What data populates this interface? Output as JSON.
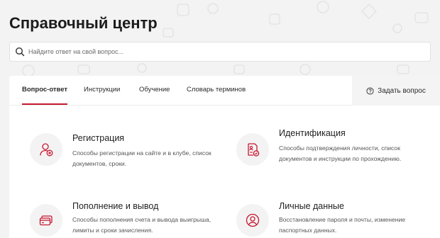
{
  "page": {
    "title": "Справочный центр"
  },
  "search": {
    "placeholder": "Найдите ответ на свой вопрос..."
  },
  "tabs": [
    {
      "label": "Вопрос-ответ",
      "active": true
    },
    {
      "label": "Инструкции",
      "active": false
    },
    {
      "label": "Обучение",
      "active": false
    },
    {
      "label": "Словарь терминов",
      "active": false
    }
  ],
  "ask_button": {
    "label": "Задать вопрос",
    "icon": "question-circle-icon"
  },
  "sections": [
    {
      "title": "Регистрация",
      "description": "Способы регистрации на сайте и в клубе, список документов, сроки.",
      "icon": "user-add-icon"
    },
    {
      "title": "Идентификация",
      "description": "Способы подтверждения личности, список документов и инструкции по прохождению.",
      "icon": "document-check-icon"
    },
    {
      "title": "Пополнение и вывод",
      "description": "Способы пополнения счета и вывода выигрыша, лимиты и сроки зачисления.",
      "icon": "cards-icon"
    },
    {
      "title": "Личные данные",
      "description": "Восстановление пароля и почты, изменение паспортных данных.",
      "icon": "user-circle-icon"
    }
  ],
  "colors": {
    "accent": "#c8192f",
    "background": "#f3f3f4",
    "icon_background": "#f3f3f4"
  }
}
